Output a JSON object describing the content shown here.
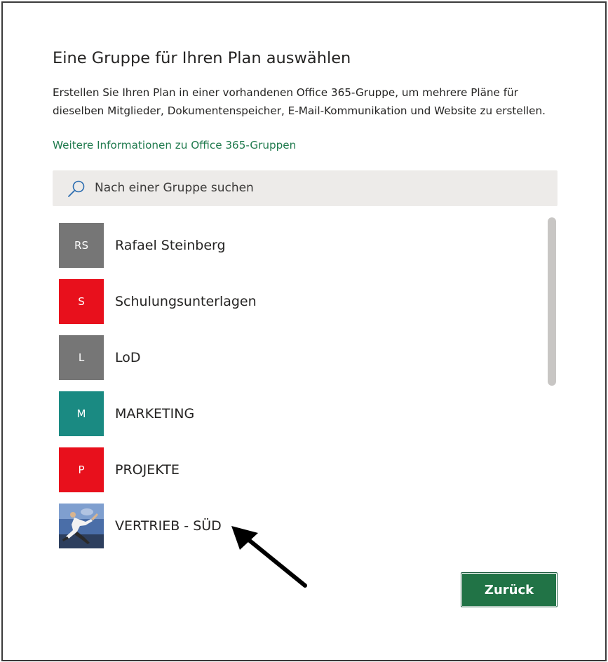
{
  "dialog": {
    "title": "Eine Gruppe für Ihren Plan auswählen",
    "description": "Erstellen Sie Ihren Plan in einer vorhandenen Office 365-Gruppe, um mehrere Pläne für dieselben Mitglieder, Dokumentenspeicher, E-Mail-Kommunikation und Website zu erstellen.",
    "learn_more_link": "Weitere Informationen zu Office 365-Gruppen"
  },
  "search": {
    "placeholder": "Nach einer Gruppe suchen",
    "value": "",
    "icon": "search-icon"
  },
  "groups": [
    {
      "initials": "RS",
      "name": "Rafael Steinberg",
      "color": "#767676"
    },
    {
      "initials": "S",
      "name": "Schulungsunterlagen",
      "color": "#e8101c"
    },
    {
      "initials": "L",
      "name": "LoD",
      "color": "#767676"
    },
    {
      "initials": "M",
      "name": "MARKETING",
      "color": "#1a8a82"
    },
    {
      "initials": "P",
      "name": "PROJEKTE",
      "color": "#e8101c"
    },
    {
      "initials": "",
      "name": "VERTRIEB - SÜD",
      "color": "",
      "avatar_type": "photo"
    }
  ],
  "buttons": {
    "back_label": "Zurück"
  },
  "colors": {
    "accent": "#217346",
    "link": "#1f7a4d",
    "search_background": "#edebe9"
  }
}
